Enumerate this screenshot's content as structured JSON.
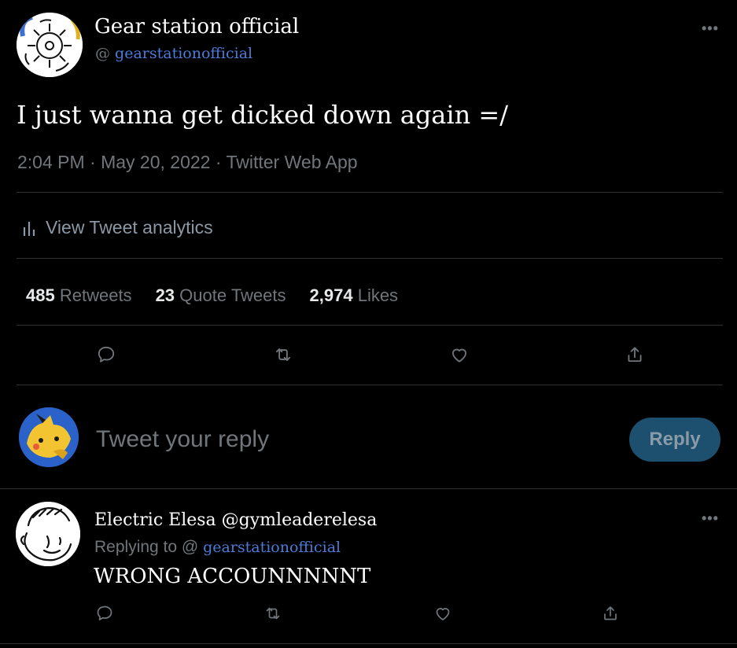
{
  "tweet": {
    "display_name": "Gear station official",
    "handle_prefix": "@",
    "handle": "gearstationofficial",
    "text": "I just wanna get dicked down again =/",
    "meta": "2:04 PM · May 20, 2022 · Twitter Web App",
    "more_label": "•••",
    "analytics_label": "View Tweet analytics",
    "stats": {
      "retweets_count": "485",
      "retweets_label": "Retweets",
      "quotes_count": "23",
      "quotes_label": "Quote Tweets",
      "likes_count": "2,974",
      "likes_label": "Likes"
    }
  },
  "composer": {
    "placeholder": "Tweet your reply",
    "reply_button": "Reply"
  },
  "reply": {
    "display_name": "Electric Elesa",
    "handle": "@gymleaderelesa",
    "replying_to_label": "Replying to @",
    "replying_to_handle": "gearstationofficial",
    "text": "WRONG ACCOUNNNNNT",
    "more_label": "•••"
  },
  "icons": [
    "comment-icon",
    "retweet-icon",
    "like-icon",
    "share-icon",
    "analytics-icon"
  ],
  "colors": {
    "background": "#000000",
    "link": "#4c7bd9",
    "reply_button": "#1d4f6e",
    "divider": "#2f3336"
  }
}
